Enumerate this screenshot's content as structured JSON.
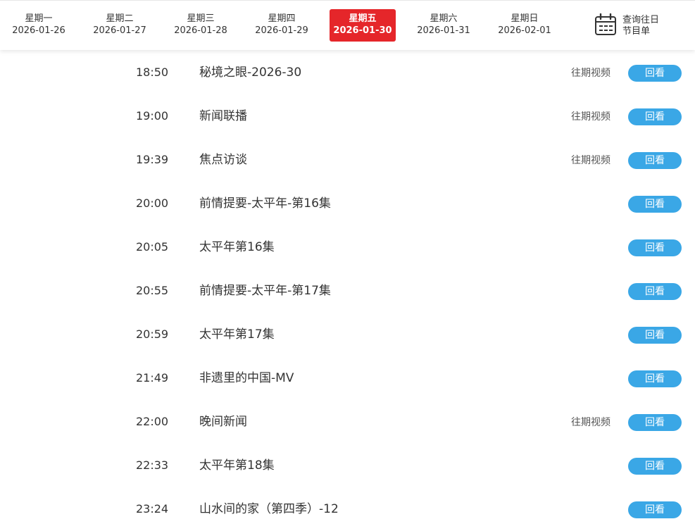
{
  "days": [
    {
      "weekday": "星期一",
      "date": "2026-01-26",
      "active": false
    },
    {
      "weekday": "星期二",
      "date": "2026-01-27",
      "active": false
    },
    {
      "weekday": "星期三",
      "date": "2026-01-28",
      "active": false
    },
    {
      "weekday": "星期四",
      "date": "2026-01-29",
      "active": false
    },
    {
      "weekday": "星期五",
      "date": "2026-01-30",
      "active": true
    },
    {
      "weekday": "星期六",
      "date": "2026-01-31",
      "active": false
    },
    {
      "weekday": "星期日",
      "date": "2026-02-01",
      "active": false
    }
  ],
  "history": {
    "label_line1": "查询往日",
    "label_line2": "节目单",
    "icon": "calendar-icon"
  },
  "colors": {
    "active_day": "#e5262a",
    "replay_button": "#3aa7e6"
  },
  "programs": [
    {
      "time": "18:50",
      "title": "秘境之眼-2026-30",
      "past_label": "往期视频",
      "replay_label": "回看"
    },
    {
      "time": "19:00",
      "title": "新闻联播",
      "past_label": "往期视频",
      "replay_label": "回看"
    },
    {
      "time": "19:39",
      "title": "焦点访谈",
      "past_label": "往期视频",
      "replay_label": "回看"
    },
    {
      "time": "20:00",
      "title": "前情提要-太平年-第16集",
      "past_label": "",
      "replay_label": "回看"
    },
    {
      "time": "20:05",
      "title": "太平年第16集",
      "past_label": "",
      "replay_label": "回看"
    },
    {
      "time": "20:55",
      "title": "前情提要-太平年-第17集",
      "past_label": "",
      "replay_label": "回看"
    },
    {
      "time": "20:59",
      "title": "太平年第17集",
      "past_label": "",
      "replay_label": "回看"
    },
    {
      "time": "21:49",
      "title": "非遗里的中国-MV",
      "past_label": "",
      "replay_label": "回看"
    },
    {
      "time": "22:00",
      "title": "晚间新闻",
      "past_label": "往期视频",
      "replay_label": "回看"
    },
    {
      "time": "22:33",
      "title": "太平年第18集",
      "past_label": "",
      "replay_label": "回看"
    },
    {
      "time": "23:24",
      "title": "山水间的家（第四季）-12",
      "past_label": "",
      "replay_label": "回看"
    }
  ]
}
